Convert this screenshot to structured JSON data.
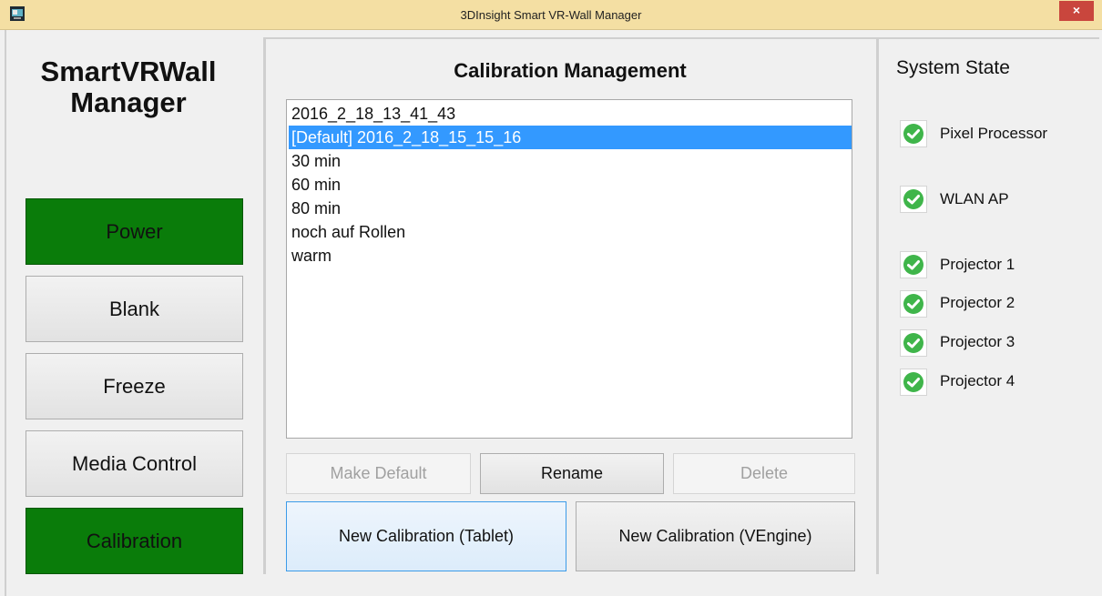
{
  "window": {
    "title": "3DInsight Smart VR-Wall Manager",
    "close_label": "×"
  },
  "left": {
    "app_title_line1": "SmartVRWall",
    "app_title_line2": "Manager",
    "nav": [
      {
        "label": "Power",
        "active": true
      },
      {
        "label": "Blank",
        "active": false
      },
      {
        "label": "Freeze",
        "active": false
      },
      {
        "label": "Media Control",
        "active": false
      },
      {
        "label": "Calibration",
        "active": true
      }
    ]
  },
  "calibration": {
    "title": "Calibration Management",
    "items": [
      "2016_2_18_13_41_43",
      "[Default] 2016_2_18_15_15_16",
      "30 min",
      "60 min",
      "80 min",
      "noch auf Rollen",
      "warm"
    ],
    "selected_item": "[Default] 2016_2_18_15_15_16",
    "buttons": {
      "make_default": "Make Default",
      "rename": "Rename",
      "delete": "Delete",
      "new_tablet": "New Calibration (Tablet)",
      "new_vengine": "New Calibration (VEngine)"
    }
  },
  "system_state": {
    "title": "System State",
    "items": [
      {
        "label": "Pixel Processor",
        "status": "ok",
        "icon": "check-circle-icon"
      },
      {
        "label": "WLAN AP",
        "status": "ok",
        "icon": "check-circle-icon"
      },
      {
        "label": "Projector 1",
        "status": "ok",
        "icon": "check-circle-icon"
      },
      {
        "label": "Projector 2",
        "status": "ok",
        "icon": "check-circle-icon"
      },
      {
        "label": "Projector 3",
        "status": "ok",
        "icon": "check-circle-icon"
      },
      {
        "label": "Projector 4",
        "status": "ok",
        "icon": "check-circle-icon"
      }
    ]
  },
  "colors": {
    "active_green": "#0a7c0a",
    "selection_blue": "#3399ff",
    "ok_green": "#3fb54a",
    "titlebar": "#f4dfa3"
  }
}
